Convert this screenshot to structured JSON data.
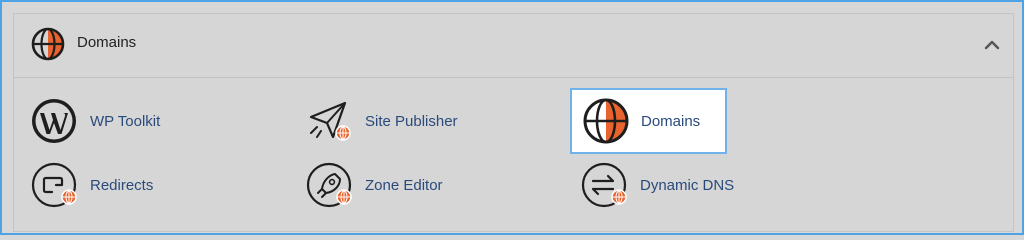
{
  "section": {
    "title": "Domains",
    "icon": "globe-icon",
    "collapse_icon": "chevron-up-icon",
    "expanded": true
  },
  "items": [
    {
      "label": "WP Toolkit",
      "icon": "wordpress-icon"
    },
    {
      "label": "Site Publisher",
      "icon": "paper-plane-globe-icon"
    },
    {
      "label": "Domains",
      "icon": "globe-icon",
      "selected": true
    },
    {
      "label": "Redirects",
      "icon": "redirect-globe-icon"
    },
    {
      "label": "Zone Editor",
      "icon": "rocket-globe-icon"
    },
    {
      "label": "Dynamic DNS",
      "icon": "swap-arrows-globe-icon"
    }
  ],
  "colors": {
    "accent_orange": "#e8632d",
    "link_blue": "#2a4a7b",
    "selection_border": "#6fb3ea",
    "frame_border": "#4da3e6"
  }
}
